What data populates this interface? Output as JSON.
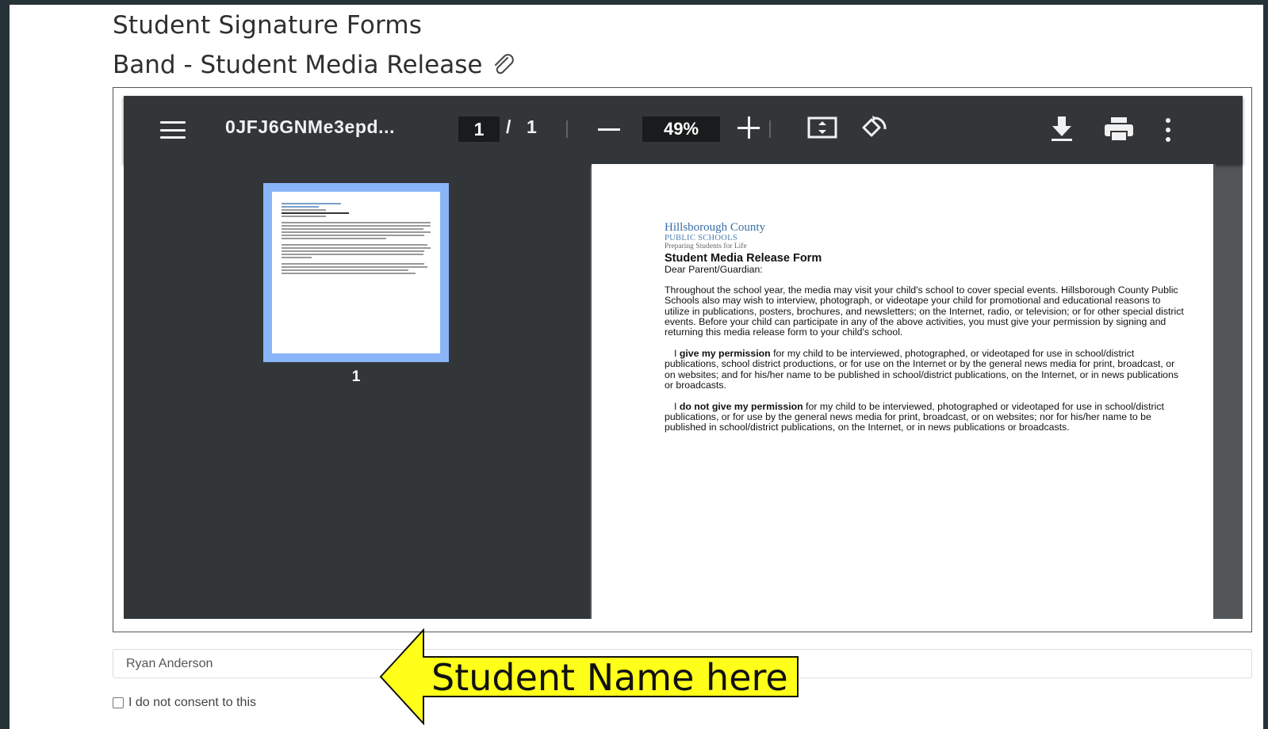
{
  "page": {
    "section_title": "Student Signature Forms",
    "form_title": "Band - Student Media Release"
  },
  "pdf_viewer": {
    "doc_title": "0JFJ6GNMe3epd...",
    "current_page": "1",
    "page_separator": "/",
    "total_pages": "1",
    "zoom": "49%",
    "thumbnail_label": "1",
    "icons": [
      "menu-icon",
      "zoom-out-icon",
      "zoom-in-icon",
      "fit-page-icon",
      "rotate-icon",
      "download-icon",
      "print-icon",
      "more-options-icon"
    ]
  },
  "document": {
    "org_name": "Hillsborough County",
    "org_sub": "PUBLIC SCHOOLS",
    "org_tagline": "Preparing Students for Life",
    "form_heading": "Student Media Release Form",
    "salutation": "Dear Parent/Guardian:",
    "intro": "Throughout the school year, the media may visit your child's school to cover special events. Hillsborough County Public Schools also may wish to interview, photograph, or videotape your child for promotional and educational reasons to utilize in publications, posters, brochures, and newsletters; on the Internet, radio, or television; or for other special district events. Before your child can participate in any of the above activities, you must give your permission by signing and returning this media release form to your child's school.",
    "option1_prefix": "I ",
    "option1_bold": "give my permission",
    "option1_rest": " for my child to be interviewed, photographed, or videotaped for use in school/district publications, school district productions, or for use on the Internet or by the general news media for print, broadcast, or on websites; and for his/her name to be published in school/district publications, on the Internet, or in news publications or broadcasts.",
    "option2_prefix": "I ",
    "option2_bold": "do not give my permission",
    "option2_rest": " for my child to be interviewed, photographed or videotaped for use in school/district publications, or for use by the general news media for print, broadcast, or on websites; nor for his/her name to be published in school/district publications, on the Internet, or in news publications or broadcasts."
  },
  "form": {
    "student_name_value": "Ryan Anderson",
    "consent_label": "I do not consent to this"
  },
  "annotation": {
    "callout_text": "Student Name here",
    "callout_color": "#ffff1a"
  },
  "colors": {
    "frame": "#263238",
    "viewer_toolbar": "#323639",
    "thumbnail_highlight": "#8ab4f8"
  }
}
